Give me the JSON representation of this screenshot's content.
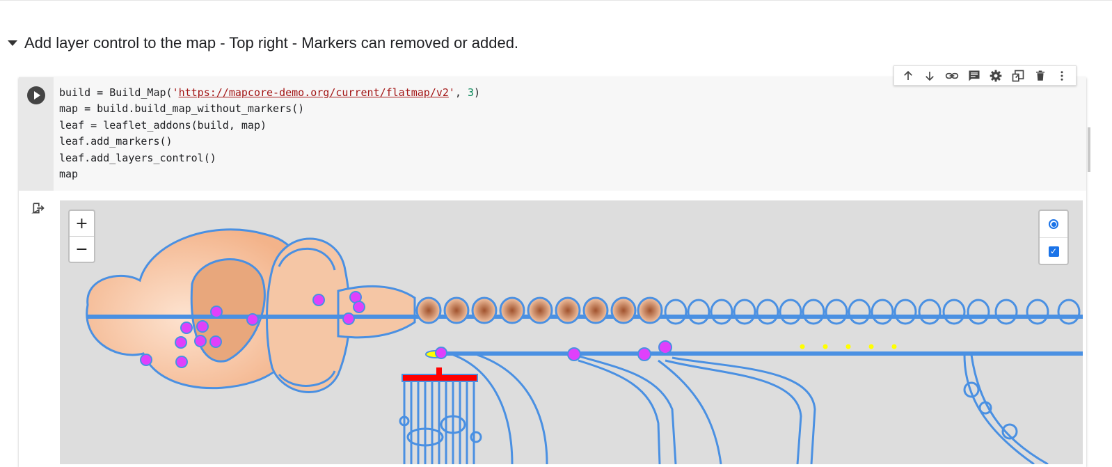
{
  "section": {
    "title": "Add layer control to the map - Top right - Markers can removed or added."
  },
  "cell": {
    "code": {
      "line1_pre": "build = Build_Map(",
      "line1_q1": "'",
      "line1_url": "https://mapcore-demo.org/current/flatmap/v2",
      "line1_q2": "'",
      "line1_mid": ", ",
      "line1_num": "3",
      "line1_post": ")",
      "line2": "map = build.build_map_without_markers()",
      "line3": "leaf = leaflet_addons(build, map)",
      "line4": "leaf.add_markers()",
      "line5": "leaf.add_layers_control()",
      "line6": "map"
    },
    "toolbar_icons": [
      "arrow-up-icon",
      "arrow-down-icon",
      "link-icon",
      "comment-icon",
      "gear-icon",
      "mirror-cell-icon",
      "trash-icon",
      "more-vert-icon"
    ]
  },
  "map": {
    "zoom_in": "+",
    "zoom_out": "−",
    "layers": {
      "base_selected": true,
      "markers_checked": true
    }
  },
  "colors": {
    "map_bg": "#dddddd",
    "outline": "#4a90e2",
    "tissue": "#f5c6a5",
    "marker": "#e040fb",
    "highlight_red": "#ff0000",
    "highlight_yellow": "#ffff00",
    "accent": "#1a73e8"
  }
}
